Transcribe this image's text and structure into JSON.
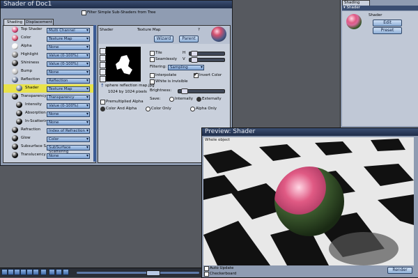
{
  "shader_window": {
    "title": "Shader of Doc1",
    "filter_label": "Filter Simple Sub-Shaders from Tree",
    "tabs": [
      "Shading",
      "Displacement"
    ],
    "rows": [
      {
        "label": "Top Shader",
        "value": "Multi Channel",
        "ball": "#d84a78"
      },
      {
        "label": "Color",
        "value": "Texture Map",
        "ball": "#d44a6a"
      },
      {
        "label": "Alpha",
        "value": "None",
        "ball": "#f4f4f4"
      },
      {
        "label": "Highlight",
        "value": "Value (0-100%)",
        "ball": "#707070"
      },
      {
        "label": "Shininess",
        "value": "Value (0-100%)",
        "ball": "#202020"
      },
      {
        "label": "Bump",
        "value": "None",
        "ball": "#c0c0c0"
      },
      {
        "label": "Reflection",
        "value": "Reflection",
        "ball": "#5a6a8a"
      },
      {
        "label": "Shader",
        "value": "Texture Map",
        "ball": "#6a7a9a"
      },
      {
        "label": "Transparency",
        "value": "Transparency",
        "ball": "#101010"
      },
      {
        "label": "Intensity",
        "value": "Value (0-100%)",
        "ball": "#101010"
      },
      {
        "label": "Absorption",
        "value": "None",
        "ball": "#101010"
      },
      {
        "label": "In-Scattering",
        "value": "None",
        "ball": "#101010"
      },
      {
        "label": "Refraction",
        "value": "Index of Refraction",
        "ball": "#101010"
      },
      {
        "label": "Glow",
        "value": "Color",
        "ball": "#101010"
      },
      {
        "label": "Subsurface S.",
        "value": "SubSurface Scattering",
        "ball": "#101010"
      },
      {
        "label": "Translucency",
        "value": "None",
        "ball": "#101010"
      }
    ],
    "detail": {
      "shader_label": "Shader",
      "texture_map_label": "Texture Map",
      "question_mark": "?",
      "wizard_label": "Wizard",
      "parent_label": "Parent",
      "tile_label": "Tile",
      "seamlessly_label": "Seamlessly",
      "h_label": "H",
      "v_label": "V",
      "filtering_label": "Filtering:",
      "filtering_value": "Sampling",
      "interpolate_label": "Interpolate",
      "invert_color_label": "Invert Color",
      "white_invisible_label": "White is invisible",
      "brightness_label": "Brightness:",
      "save_label": "Save:",
      "internally_label": "Internally",
      "externally_label": "Externally",
      "file_name": "sphere reflection map.jpg",
      "file_size": "1024 by 1024 pixels",
      "premultiplied_label": "Premultiplied Alpha",
      "color_and_alpha_label": "Color And Alpha",
      "color_only_label": "Color Only",
      "alpha_only_label": "Alpha Only"
    }
  },
  "right_panel": {
    "tab": "Shading",
    "header": "Shader",
    "item_label": "Shader",
    "edit_label": "Edit",
    "preset_label": "Preset"
  },
  "preview": {
    "title": "Preview: Shader",
    "object_label": "Whole object",
    "auto_update_label": "Auto Update",
    "checkerboard_label": "Checkerboard",
    "render_label": "Render"
  },
  "colors": {
    "accent": "#3a5a94",
    "highlight_row": "#e8e24a",
    "sphere_pink": "#e05a84",
    "sphere_green": "#3c5a2e"
  }
}
